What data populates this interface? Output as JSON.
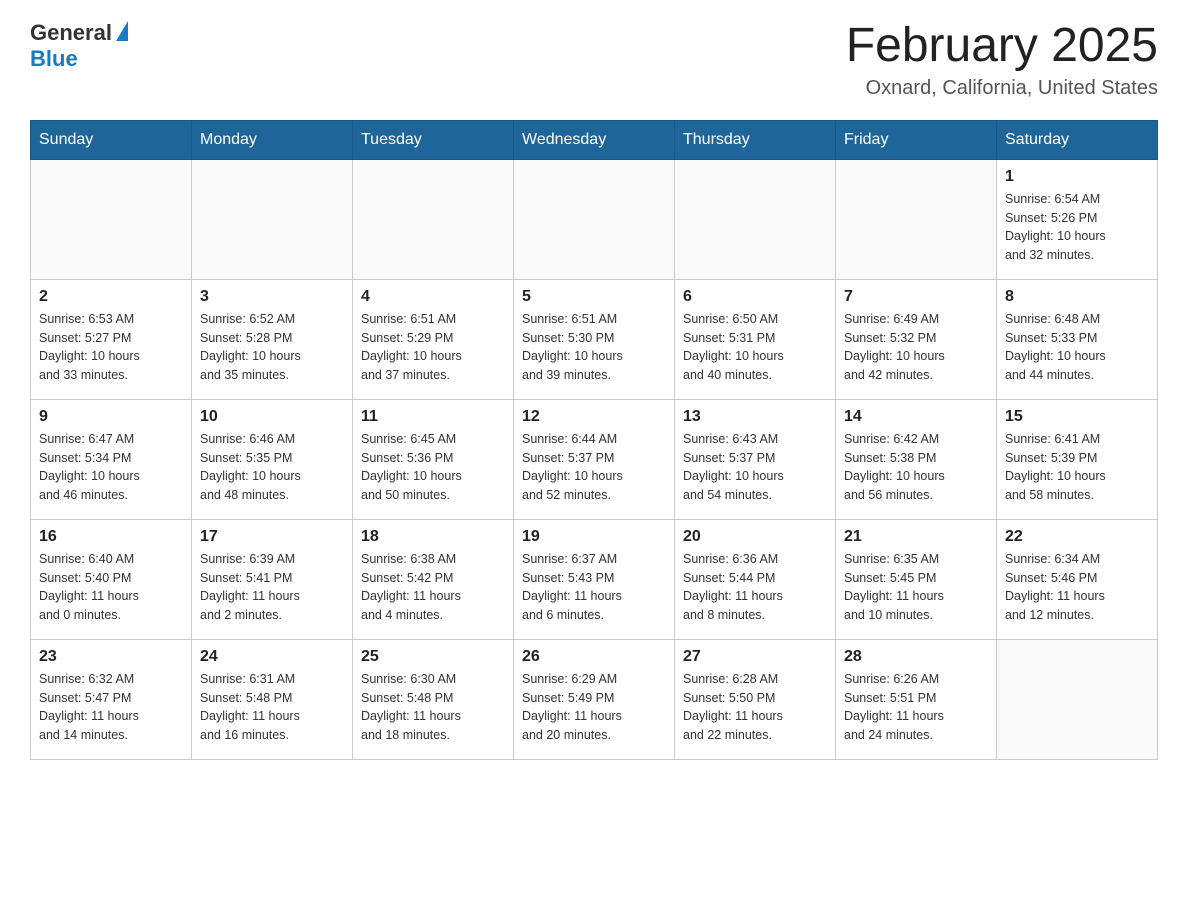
{
  "header": {
    "logo_general": "General",
    "logo_blue": "Blue",
    "title": "February 2025",
    "subtitle": "Oxnard, California, United States"
  },
  "weekdays": [
    "Sunday",
    "Monday",
    "Tuesday",
    "Wednesday",
    "Thursday",
    "Friday",
    "Saturday"
  ],
  "weeks": [
    [
      {
        "day": "",
        "info": ""
      },
      {
        "day": "",
        "info": ""
      },
      {
        "day": "",
        "info": ""
      },
      {
        "day": "",
        "info": ""
      },
      {
        "day": "",
        "info": ""
      },
      {
        "day": "",
        "info": ""
      },
      {
        "day": "1",
        "info": "Sunrise: 6:54 AM\nSunset: 5:26 PM\nDaylight: 10 hours\nand 32 minutes."
      }
    ],
    [
      {
        "day": "2",
        "info": "Sunrise: 6:53 AM\nSunset: 5:27 PM\nDaylight: 10 hours\nand 33 minutes."
      },
      {
        "day": "3",
        "info": "Sunrise: 6:52 AM\nSunset: 5:28 PM\nDaylight: 10 hours\nand 35 minutes."
      },
      {
        "day": "4",
        "info": "Sunrise: 6:51 AM\nSunset: 5:29 PM\nDaylight: 10 hours\nand 37 minutes."
      },
      {
        "day": "5",
        "info": "Sunrise: 6:51 AM\nSunset: 5:30 PM\nDaylight: 10 hours\nand 39 minutes."
      },
      {
        "day": "6",
        "info": "Sunrise: 6:50 AM\nSunset: 5:31 PM\nDaylight: 10 hours\nand 40 minutes."
      },
      {
        "day": "7",
        "info": "Sunrise: 6:49 AM\nSunset: 5:32 PM\nDaylight: 10 hours\nand 42 minutes."
      },
      {
        "day": "8",
        "info": "Sunrise: 6:48 AM\nSunset: 5:33 PM\nDaylight: 10 hours\nand 44 minutes."
      }
    ],
    [
      {
        "day": "9",
        "info": "Sunrise: 6:47 AM\nSunset: 5:34 PM\nDaylight: 10 hours\nand 46 minutes."
      },
      {
        "day": "10",
        "info": "Sunrise: 6:46 AM\nSunset: 5:35 PM\nDaylight: 10 hours\nand 48 minutes."
      },
      {
        "day": "11",
        "info": "Sunrise: 6:45 AM\nSunset: 5:36 PM\nDaylight: 10 hours\nand 50 minutes."
      },
      {
        "day": "12",
        "info": "Sunrise: 6:44 AM\nSunset: 5:37 PM\nDaylight: 10 hours\nand 52 minutes."
      },
      {
        "day": "13",
        "info": "Sunrise: 6:43 AM\nSunset: 5:37 PM\nDaylight: 10 hours\nand 54 minutes."
      },
      {
        "day": "14",
        "info": "Sunrise: 6:42 AM\nSunset: 5:38 PM\nDaylight: 10 hours\nand 56 minutes."
      },
      {
        "day": "15",
        "info": "Sunrise: 6:41 AM\nSunset: 5:39 PM\nDaylight: 10 hours\nand 58 minutes."
      }
    ],
    [
      {
        "day": "16",
        "info": "Sunrise: 6:40 AM\nSunset: 5:40 PM\nDaylight: 11 hours\nand 0 minutes."
      },
      {
        "day": "17",
        "info": "Sunrise: 6:39 AM\nSunset: 5:41 PM\nDaylight: 11 hours\nand 2 minutes."
      },
      {
        "day": "18",
        "info": "Sunrise: 6:38 AM\nSunset: 5:42 PM\nDaylight: 11 hours\nand 4 minutes."
      },
      {
        "day": "19",
        "info": "Sunrise: 6:37 AM\nSunset: 5:43 PM\nDaylight: 11 hours\nand 6 minutes."
      },
      {
        "day": "20",
        "info": "Sunrise: 6:36 AM\nSunset: 5:44 PM\nDaylight: 11 hours\nand 8 minutes."
      },
      {
        "day": "21",
        "info": "Sunrise: 6:35 AM\nSunset: 5:45 PM\nDaylight: 11 hours\nand 10 minutes."
      },
      {
        "day": "22",
        "info": "Sunrise: 6:34 AM\nSunset: 5:46 PM\nDaylight: 11 hours\nand 12 minutes."
      }
    ],
    [
      {
        "day": "23",
        "info": "Sunrise: 6:32 AM\nSunset: 5:47 PM\nDaylight: 11 hours\nand 14 minutes."
      },
      {
        "day": "24",
        "info": "Sunrise: 6:31 AM\nSunset: 5:48 PM\nDaylight: 11 hours\nand 16 minutes."
      },
      {
        "day": "25",
        "info": "Sunrise: 6:30 AM\nSunset: 5:48 PM\nDaylight: 11 hours\nand 18 minutes."
      },
      {
        "day": "26",
        "info": "Sunrise: 6:29 AM\nSunset: 5:49 PM\nDaylight: 11 hours\nand 20 minutes."
      },
      {
        "day": "27",
        "info": "Sunrise: 6:28 AM\nSunset: 5:50 PM\nDaylight: 11 hours\nand 22 minutes."
      },
      {
        "day": "28",
        "info": "Sunrise: 6:26 AM\nSunset: 5:51 PM\nDaylight: 11 hours\nand 24 minutes."
      },
      {
        "day": "",
        "info": ""
      }
    ]
  ]
}
